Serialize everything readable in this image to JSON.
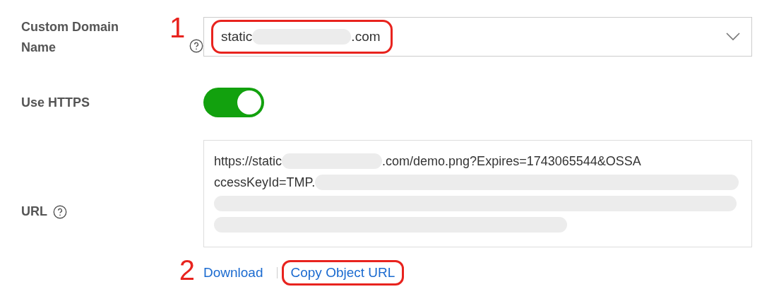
{
  "domain": {
    "label": "Custom Domain Name",
    "value_start": "static",
    "value_end": ".com",
    "annotation": "1",
    "highlighted": true
  },
  "https": {
    "label": "Use HTTPS",
    "on": true
  },
  "url": {
    "label": "URL",
    "line_1_start": "https://static",
    "line_1_end": ".com/demo.png?Expires=1743065544&OSSA",
    "line_2": "ccessKeyId=TMP."
  },
  "links": [
    {
      "label": "Download",
      "highlighted": false
    },
    {
      "label": "Copy Object URL",
      "highlighted": true
    }
  ],
  "links_annotation": "2"
}
